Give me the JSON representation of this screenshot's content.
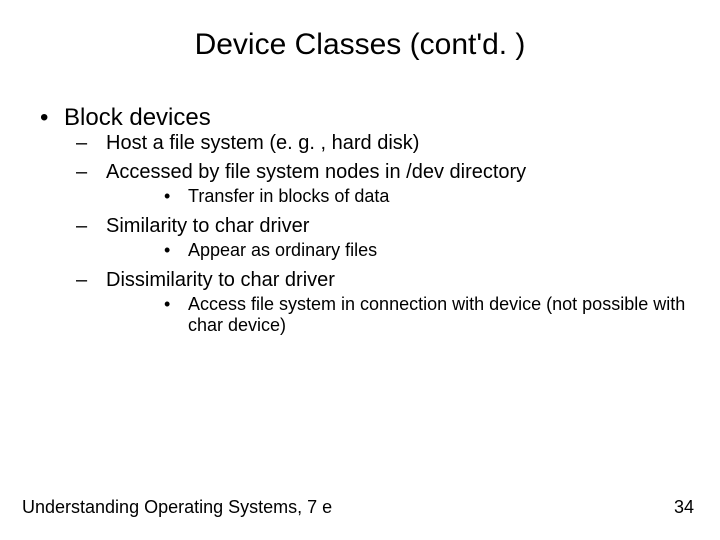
{
  "title": "Device Classes (cont'd. )",
  "bullets": {
    "l1_0": "Block devices",
    "l2_0": "Host a file system (e. g. , hard disk)",
    "l2_1": "Accessed by file system nodes in /dev directory",
    "l3_0": "Transfer in blocks of data",
    "l2_2": "Similarity to char driver",
    "l3_1": "Appear as ordinary files",
    "l2_3": "Dissimilarity to char driver",
    "l3_2": "Access file system in connection with device (not possible with char device)"
  },
  "footer": {
    "left": "Understanding Operating Systems, 7 e",
    "page": "34"
  }
}
